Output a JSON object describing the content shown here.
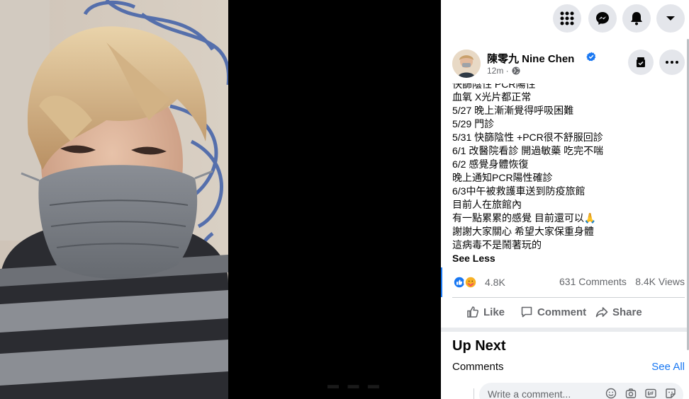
{
  "top_bar": {
    "menu_icon": "grid-menu-icon",
    "messenger_icon": "messenger-icon",
    "notifications_icon": "bell-icon",
    "account_icon": "caret-down-icon"
  },
  "post": {
    "author": "陳零九 Nine Chen",
    "time": "12m ·",
    "privacy_icon": "globe-icon",
    "lines": [
      "快篩陰性 PCR陽性",
      "血氧 X光片都正常",
      "5/27 晚上漸漸覺得呼吸困難",
      "5/29 門診",
      "5/31 快篩陰性 +PCR很不舒服回診",
      "6/1 改醫院看診 開過敏藥 吃完不喘",
      "6/2 感覺身體恢復",
      "晚上通知PCR陽性確診",
      "6/3中午被救護車送到防疫旅館",
      "目前人在旅館內",
      "有一點累累的感覺 目前還可以🙏",
      "謝謝大家關心 希望大家保重身體",
      "這病毒不是鬧著玩的"
    ],
    "see_less": "See Less"
  },
  "stats": {
    "reactions": "4.8K",
    "comments": "631 Comments",
    "views": "8.4K Views"
  },
  "actions": {
    "like": "Like",
    "comment": "Comment",
    "share": "Share"
  },
  "up_next": "Up Next",
  "comments_section": {
    "label": "Comments",
    "see_all": "See All",
    "placeholder": "Write a comment..."
  },
  "colors": {
    "accent": "#1877f2",
    "secondary_text": "#65676b",
    "button_bg": "#e4e6eb"
  }
}
